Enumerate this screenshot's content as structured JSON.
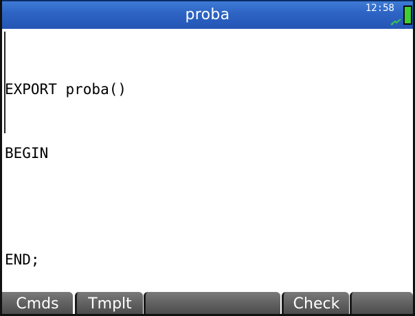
{
  "header": {
    "title": "proba",
    "time": "12:58",
    "battery_icon": "battery-icon",
    "charging_icon": "charging-plug-icon",
    "bar_color": "#2d63c3"
  },
  "editor": {
    "lines": [
      "EXPORT proba()",
      "BEGIN",
      "",
      "END;"
    ]
  },
  "menu": {
    "keys": [
      "Cmds",
      "Tmplt",
      "",
      "Check",
      ""
    ]
  }
}
